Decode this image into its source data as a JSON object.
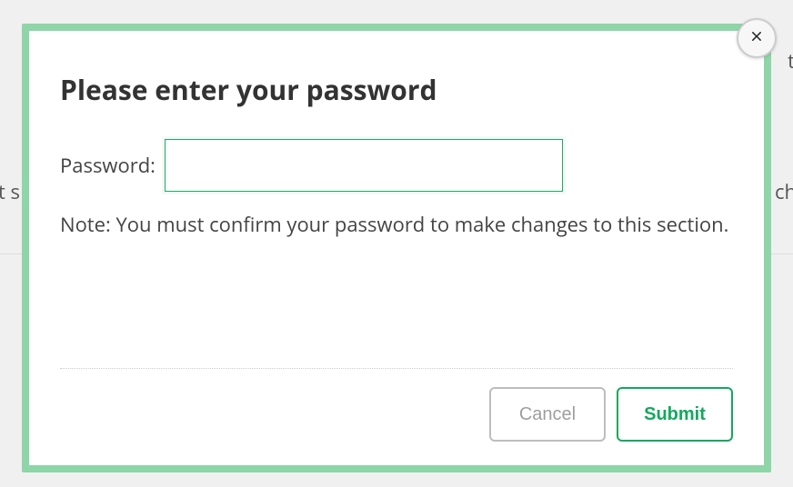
{
  "modal": {
    "title": "Please enter your password",
    "field_label": "Password:",
    "input_value": "",
    "note": "Note: You must confirm your password to make changes to this section.",
    "cancel_label": "Cancel",
    "submit_label": "Submit"
  },
  "backdrop": {
    "left_fragment": "t s",
    "right_top_fragment": "t",
    "right_fragment": "ch",
    "top_fragment": ""
  }
}
